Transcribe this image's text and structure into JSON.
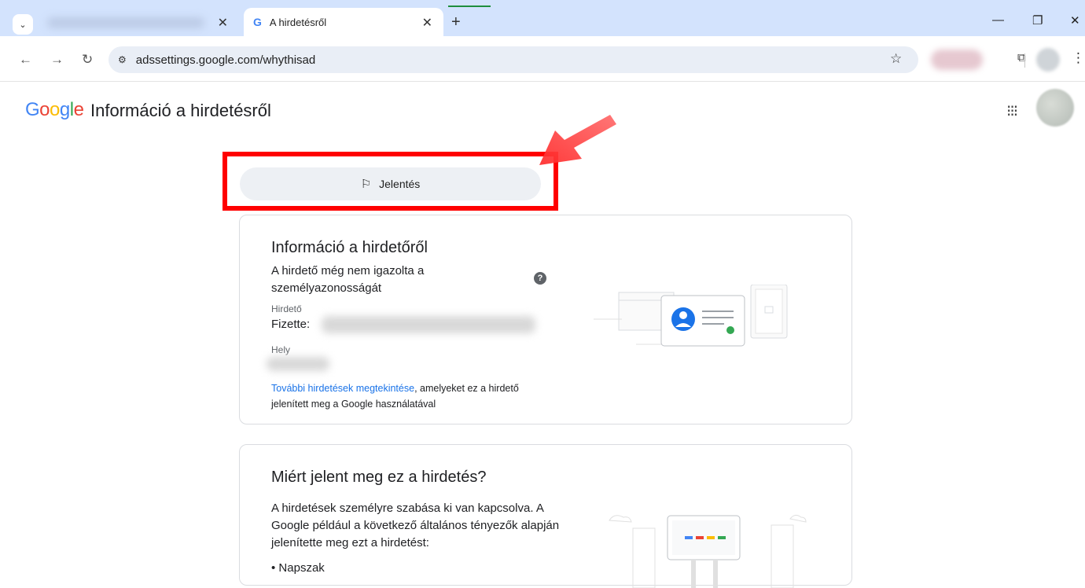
{
  "browser": {
    "active_tab_title": "A hirdetésről",
    "url": "adssettings.google.com/whythisad",
    "colors": {
      "tab_strip": "#d3e3fd",
      "omnibox": "#e9eef6"
    }
  },
  "header": {
    "logo_text": "Google",
    "title": "Információ a hirdetésről"
  },
  "report": {
    "label": "Jelentés"
  },
  "advertiser_card": {
    "heading": "Információ a hirdetőről",
    "verification_text": "A hirdető még nem igazolta a személyazonosságát",
    "advertiser_label": "Hirdető",
    "paid_by_label": "Fizette:",
    "location_label": "Hely",
    "more_ads_link": "További hirdetések megtekintése",
    "more_ads_suffix": ", amelyeket ez a hirdető jelenített meg a Google használatával"
  },
  "why_card": {
    "heading": "Miért jelent meg ez a hirdetés?",
    "body": "A hirdetések személyre szabása ki van kapcsolva. A Google például a következő általános tényezők alapján jelenítette meg ezt a hirdetést:",
    "factors": [
      "Napszak"
    ]
  },
  "colors": {
    "annotation_red": "#ff0000",
    "link_blue": "#1a73e8",
    "google_blue": "#4285f4",
    "google_red": "#ea4335",
    "google_yellow": "#fbbc05",
    "google_green": "#34a853"
  }
}
